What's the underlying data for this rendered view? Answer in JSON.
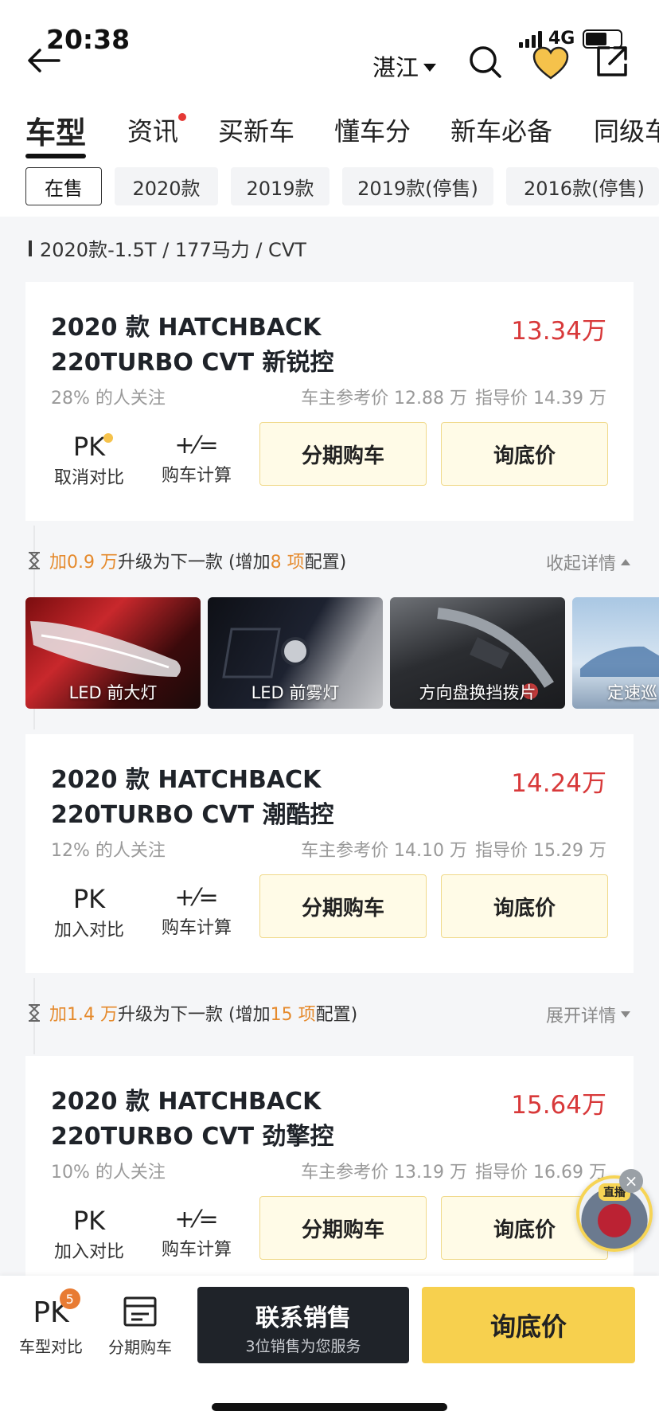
{
  "status_bar": {
    "time": "20:38",
    "network": "4G"
  },
  "header": {
    "city": "湛江"
  },
  "tabs": [
    {
      "label": "车型",
      "active": true
    },
    {
      "label": "资讯",
      "has_dot": true
    },
    {
      "label": "买新车"
    },
    {
      "label": "懂车分"
    },
    {
      "label": "新车必备"
    },
    {
      "label": "同级车"
    }
  ],
  "filters": [
    "在售",
    "2020款",
    "2019款",
    "2019款(停售)",
    "2016款(停售)"
  ],
  "section_title": "2020款-1.5T / 177马力 / CVT",
  "cards": [
    {
      "name": "2020 款 HATCHBACK 220TURBO CVT 新锐控",
      "price": "13.34万",
      "attention": "28% 的人关注",
      "owner_price": "车主参考价 12.88 万",
      "guide_price": "指导价 14.39 万",
      "pk_label": "取消对比",
      "calc_label": "购车计算",
      "btn_finance": "分期购车",
      "btn_ask": "询底价"
    },
    {
      "name": "2020 款 HATCHBACK 220TURBO CVT 潮酷控",
      "price": "14.24万",
      "attention": "12% 的人关注",
      "owner_price": "车主参考价 14.10 万",
      "guide_price": "指导价 15.29 万",
      "pk_label": "加入对比",
      "calc_label": "购车计算",
      "btn_finance": "分期购车",
      "btn_ask": "询底价"
    },
    {
      "name": "2020 款 HATCHBACK 220TURBO CVT 劲擎控",
      "price": "15.64万",
      "attention": "10% 的人关注",
      "owner_price": "车主参考价 13.19 万",
      "guide_price": "指导价 16.69 万",
      "pk_label": "加入对比",
      "calc_label": "购车计算",
      "btn_finance": "分期购车",
      "btn_ask": "询底价"
    }
  ],
  "upgrades": [
    {
      "prefix": "加",
      "amount": "0.9 万",
      "middle": "升级为下一款 (增加 ",
      "items": "8 项",
      "suffix": "配置)",
      "toggle": "收起详情"
    },
    {
      "prefix": "加",
      "amount": "1.4 万",
      "middle": "升级为下一款 (增加 ",
      "items": "15 项",
      "suffix": "配置)",
      "toggle": "展开详情"
    }
  ],
  "features": [
    {
      "label": "LED 前大灯"
    },
    {
      "label": "LED 前雾灯"
    },
    {
      "label": "方向盘换挡拨片"
    },
    {
      "label": "定速巡"
    }
  ],
  "live_label": "直播",
  "bottom": {
    "pk_count": "5",
    "pk_label": "车型对比",
    "finance_label": "分期购车",
    "contact_title": "联系销售",
    "contact_sub": "3位销售为您服务",
    "ask": "询底价"
  },
  "pk_glyph": "PK",
  "calc_glyph": "+⁄=",
  "colors": {
    "price_red": "#d8393a",
    "accent_orange": "#e58a2c",
    "yellow": "#f7d04e",
    "dark": "#1f2329"
  }
}
